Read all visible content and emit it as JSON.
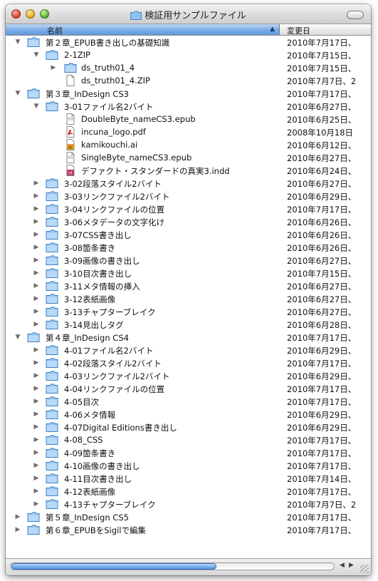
{
  "window": {
    "title": "検証用サンプルファイル"
  },
  "columns": {
    "name": "名前",
    "date": "変更日"
  },
  "rows": [
    {
      "level": 0,
      "kind": "folder",
      "tri": "down",
      "name": "第２章_EPUB書き出しの基礎知識",
      "date": "2010年7月17日、"
    },
    {
      "level": 1,
      "kind": "folder",
      "tri": "down",
      "name": "2-1ZIP",
      "date": "2010年7月15日、"
    },
    {
      "level": 2,
      "kind": "folder",
      "tri": "right",
      "name": "ds_truth01_4",
      "date": "2010年7月15日、"
    },
    {
      "level": 2,
      "kind": "doc",
      "tri": "none",
      "name": "ds_truth01_4.ZIP",
      "date": "2010年7月7日、2"
    },
    {
      "level": 0,
      "kind": "folder",
      "tri": "down",
      "name": "第３章_InDesign CS3",
      "date": "2010年7月17日、"
    },
    {
      "level": 1,
      "kind": "folder",
      "tri": "down",
      "name": "3-01ファイル名2バイト",
      "date": "2010年6月27日、"
    },
    {
      "level": 2,
      "kind": "epub",
      "tri": "none",
      "name": "DoubleByte_nameCS3.epub",
      "date": "2010年6月25日、"
    },
    {
      "level": 2,
      "kind": "pdf",
      "tri": "none",
      "name": "incuna_logo.pdf",
      "date": "2008年10月18日"
    },
    {
      "level": 2,
      "kind": "ai",
      "tri": "none",
      "name": "kamikouchi.ai",
      "date": "2010年6月12日、"
    },
    {
      "level": 2,
      "kind": "epub",
      "tri": "none",
      "name": "SingleByte_nameCS3.epub",
      "date": "2010年6月27日、"
    },
    {
      "level": 2,
      "kind": "indd",
      "tri": "none",
      "name": "デファクト・スタンダードの真実3.indd",
      "date": "2010年6月24日、"
    },
    {
      "level": 1,
      "kind": "folder",
      "tri": "right",
      "name": "3-02段落スタイル2バイト",
      "date": "2010年6月27日、"
    },
    {
      "level": 1,
      "kind": "folder",
      "tri": "right",
      "name": "3-03リンクファイル2バイト",
      "date": "2010年6月29日、"
    },
    {
      "level": 1,
      "kind": "folder",
      "tri": "right",
      "name": "3-04リンクファイルの位置",
      "date": "2010年7月17日、"
    },
    {
      "level": 1,
      "kind": "folder",
      "tri": "right",
      "name": "3-06メタデータの文字化け",
      "date": "2010年6月26日、"
    },
    {
      "level": 1,
      "kind": "folder",
      "tri": "right",
      "name": "3-07CSS書き出し",
      "date": "2010年6月26日、"
    },
    {
      "level": 1,
      "kind": "folder",
      "tri": "right",
      "name": "3-08箇条書き",
      "date": "2010年6月26日、"
    },
    {
      "level": 1,
      "kind": "folder",
      "tri": "right",
      "name": "3-09画像の書き出し",
      "date": "2010年6月27日、"
    },
    {
      "level": 1,
      "kind": "folder",
      "tri": "right",
      "name": "3-10目次書き出し",
      "date": "2010年7月15日、"
    },
    {
      "level": 1,
      "kind": "folder",
      "tri": "right",
      "name": "3-11メタ情報の挿入",
      "date": "2010年6月27日、"
    },
    {
      "level": 1,
      "kind": "folder",
      "tri": "right",
      "name": "3-12表紙画像",
      "date": "2010年6月27日、"
    },
    {
      "level": 1,
      "kind": "folder",
      "tri": "right",
      "name": "3-13チャプターブレイク",
      "date": "2010年6月27日、"
    },
    {
      "level": 1,
      "kind": "folder",
      "tri": "right",
      "name": "3-14見出しタグ",
      "date": "2010年6月28日、"
    },
    {
      "level": 0,
      "kind": "folder",
      "tri": "down",
      "name": "第４章_InDesign CS4",
      "date": "2010年7月17日、"
    },
    {
      "level": 1,
      "kind": "folder",
      "tri": "right",
      "name": "4-01ファイル名2バイト",
      "date": "2010年6月29日、"
    },
    {
      "level": 1,
      "kind": "folder",
      "tri": "right",
      "name": "4-02段落スタイル2バイト",
      "date": "2010年7月17日、"
    },
    {
      "level": 1,
      "kind": "folder",
      "tri": "right",
      "name": "4-03リンクファイル2バイト",
      "date": "2010年6月29日、"
    },
    {
      "level": 1,
      "kind": "folder",
      "tri": "right",
      "name": "4-04リンクファイルの位置",
      "date": "2010年7月17日、"
    },
    {
      "level": 1,
      "kind": "folder",
      "tri": "right",
      "name": "4-05目次",
      "date": "2010年7月17日、"
    },
    {
      "level": 1,
      "kind": "folder",
      "tri": "right",
      "name": "4-06メタ情報",
      "date": "2010年6月29日、"
    },
    {
      "level": 1,
      "kind": "folder",
      "tri": "right",
      "name": "4-07Digital Editions書き出し",
      "date": "2010年6月29日、"
    },
    {
      "level": 1,
      "kind": "folder",
      "tri": "right",
      "name": "4-08_CSS",
      "date": "2010年7月17日、"
    },
    {
      "level": 1,
      "kind": "folder",
      "tri": "right",
      "name": "4-09箇条書き",
      "date": "2010年7月17日、"
    },
    {
      "level": 1,
      "kind": "folder",
      "tri": "right",
      "name": "4-10画像の書き出し",
      "date": "2010年7月17日、"
    },
    {
      "level": 1,
      "kind": "folder",
      "tri": "right",
      "name": "4-11目次書き出し",
      "date": "2010年7月14日、"
    },
    {
      "level": 1,
      "kind": "folder",
      "tri": "right",
      "name": "4-12表紙画像",
      "date": "2010年7月17日、"
    },
    {
      "level": 1,
      "kind": "folder",
      "tri": "right",
      "name": "4-13チャプターブレイク",
      "date": "2010年7月7日、2"
    },
    {
      "level": 0,
      "kind": "folder",
      "tri": "right",
      "name": "第５章_InDesign CS5",
      "date": "2010年7月17日、"
    },
    {
      "level": 0,
      "kind": "folder",
      "tri": "right",
      "name": "第６章_EPUBをSigilで編集",
      "date": "2010年7月17日、"
    }
  ],
  "icons": {
    "folder": "folder-icon",
    "doc": "document-icon",
    "epub": "epub-document-icon",
    "pdf": "pdf-document-icon",
    "ai": "illustrator-document-icon",
    "indd": "indesign-document-icon"
  },
  "colors": {
    "header_selected": "#7fb0e6",
    "folder": "#8fc1f0",
    "scroll_thumb": "#7db2ee"
  }
}
